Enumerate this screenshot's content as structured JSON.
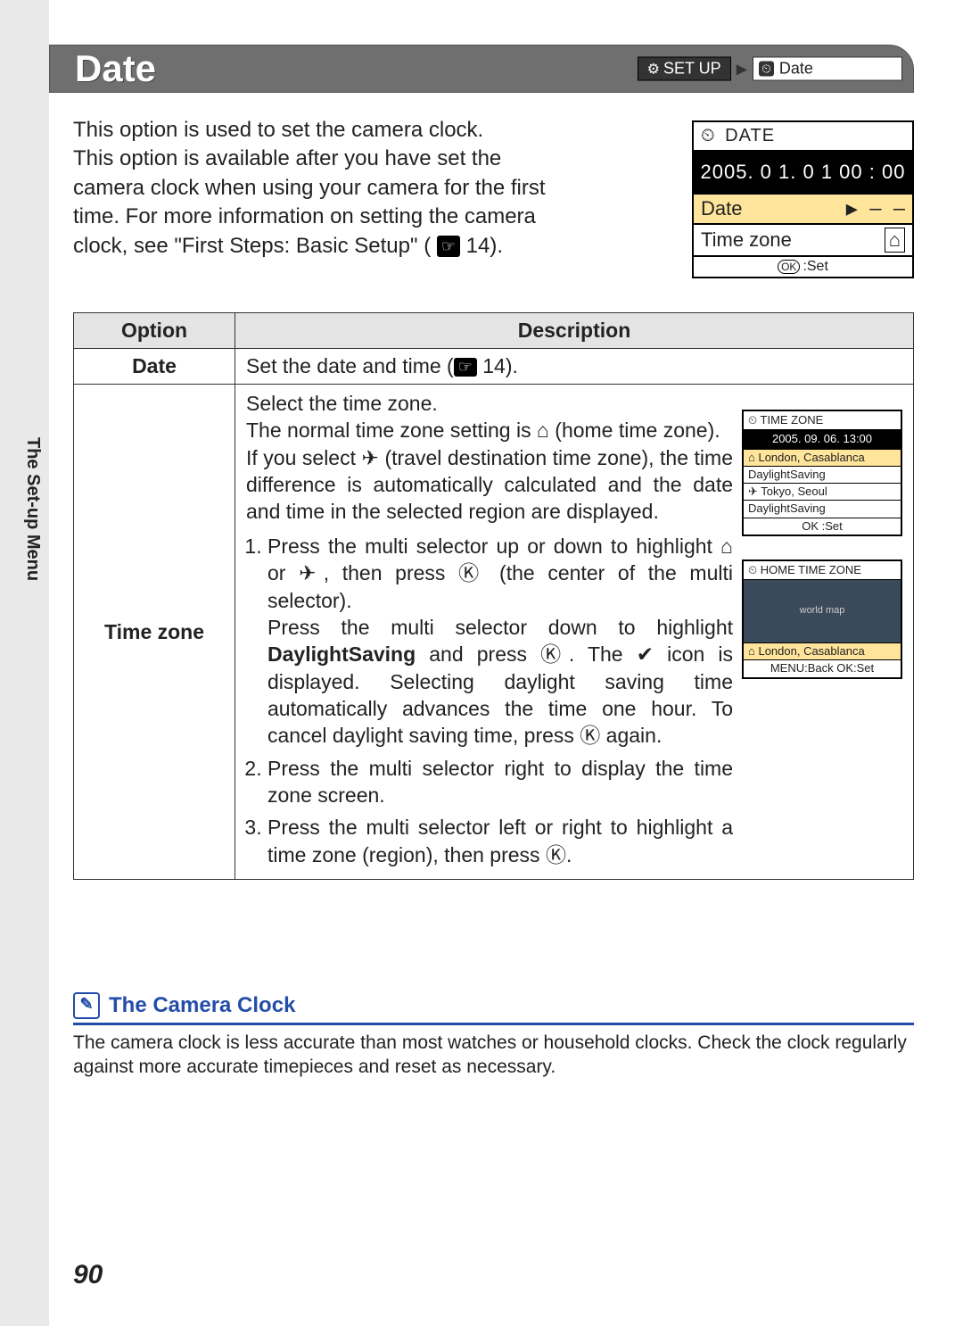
{
  "header": {
    "title": "Date",
    "breadcrumb": {
      "setup_icon": "⚙",
      "setup_label": "SET UP",
      "arrow": "▶",
      "date_icon": "⏲",
      "date_label": "Date"
    }
  },
  "intro": {
    "p1": "This option is used to set the camera clock.",
    "p2a": "This option is available after you have set the camera clock when using your camera for the first time. For more information on setting the camera clock, see \"First Steps: Basic Setup\" (",
    "p2_ref": "14",
    "p2b": ")."
  },
  "date_sample": {
    "title": "DATE",
    "datetime": "2005. 0 1. 0 1   00 : 00",
    "row_date": "Date",
    "row_date_dash": "▶   – –",
    "row_tz": "Time zone",
    "row_tz_icon": "⌂",
    "foot_ok": "OK",
    "foot_set": ":Set"
  },
  "table": {
    "col_option": "Option",
    "col_desc": "Description",
    "date": {
      "label": "Date",
      "desc_a": "Set the date and time (",
      "desc_ref": "14",
      "desc_b": ")."
    },
    "tz": {
      "label": "Time zone",
      "p1": "Select the time zone.",
      "p2_a": "The normal time zone setting is ",
      "p2_home_sym": "⌂",
      "p2_b": " (home time zone).",
      "p3_a": "If you select ",
      "p3_plane_sym": "✈",
      "p3_b": " (travel destination time zone), the time difference is automatically calculated and the date and time in the selected region are displayed.",
      "step1_a": "Press the multi selector up or down to highlight ",
      "step1_home": "⌂",
      "step1_mid": " or ",
      "step1_plane": "✈",
      "step1_b": ", then press ",
      "step1_ok": "Ⓚ",
      "step1_c": " (the center of the multi selector).",
      "step1_d_a": "Press the multi selector down to highlight ",
      "step1_ds": "DaylightSaving",
      "step1_d_b": " and press ",
      "step1_d_c": ". The ",
      "step1_check": "✔",
      "step1_d_d": " icon is displayed. Selecting daylight saving time automatically advances the time one hour. To cancel daylight saving time, press ",
      "step1_d_e": " again.",
      "step2": "Press the multi selector right to display the time zone screen.",
      "step3_a": "Press the multi selector left or right to highlight a time zone (region), then press ",
      "step3_b": "."
    },
    "mini_tz": {
      "title": "⏲ TIME ZONE",
      "dt": "2005. 09. 06.  13:00",
      "row1": "⌂ London, Casablanca",
      "row2": "  DaylightSaving",
      "row3": "✈ Tokyo, Seoul",
      "row4": "  DaylightSaving",
      "foot": "OK :Set"
    },
    "mini_home": {
      "title": "⏲ HOME TIME ZONE",
      "map_label": "world map",
      "row1": "⌂ London, Casablanca",
      "foot": "MENU:Back   OK:Set"
    }
  },
  "side_label": "The Set-up Menu",
  "note": {
    "title": "The Camera Clock",
    "body": "The camera clock is less accurate than most watches or household clocks. Check the clock regularly against more accurate timepieces and reset as necessary."
  },
  "page_number": "90"
}
